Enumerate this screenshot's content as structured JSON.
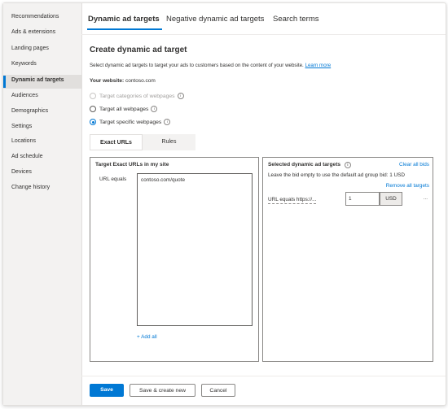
{
  "sidebar": {
    "items": [
      {
        "label": "Recommendations"
      },
      {
        "label": "Ads & extensions"
      },
      {
        "label": "Landing pages"
      },
      {
        "label": "Keywords"
      },
      {
        "label": "Dynamic ad targets"
      },
      {
        "label": "Audiences"
      },
      {
        "label": "Demographics"
      },
      {
        "label": "Settings"
      },
      {
        "label": "Locations"
      },
      {
        "label": "Ad schedule"
      },
      {
        "label": "Devices"
      },
      {
        "label": "Change history"
      }
    ],
    "active_index": 4
  },
  "tabs": [
    {
      "label": "Dynamic ad targets"
    },
    {
      "label": "Negative dynamic ad targets"
    },
    {
      "label": "Search terms"
    }
  ],
  "main": {
    "title": "Create dynamic ad target",
    "description": "Select dynamic ad targets to target your ads to customers based on the content of your website.",
    "learn_more": "Learn more",
    "website_label": "Your website:",
    "website_value": "contoso.com",
    "options": [
      {
        "label": "Target categories of webpages",
        "state": "disabled"
      },
      {
        "label": "Target all webpages",
        "state": "unchecked"
      },
      {
        "label": "Target specific webpages",
        "state": "checked"
      }
    ],
    "segments": [
      {
        "label": "Exact URLs"
      },
      {
        "label": "Rules"
      }
    ]
  },
  "left_panel": {
    "title": "Target Exact URLs in my site",
    "field_label": "URL equals",
    "field_value": "contoso.com/quote",
    "add_all": "+ Add all"
  },
  "right_panel": {
    "title": "Selected dynamic ad targets",
    "clear_all": "Clear all bids",
    "hint": "Leave the bid empty to use the default ad group bid: 1 USD",
    "remove_all": "Remove all targets",
    "row_label": "URL equals https://...",
    "bid_value": "1",
    "currency": "USD",
    "more": "..."
  },
  "footer": {
    "save": "Save",
    "save_create": "Save & create new",
    "cancel": "Cancel"
  },
  "colors": {
    "accent": "#0078d4"
  }
}
